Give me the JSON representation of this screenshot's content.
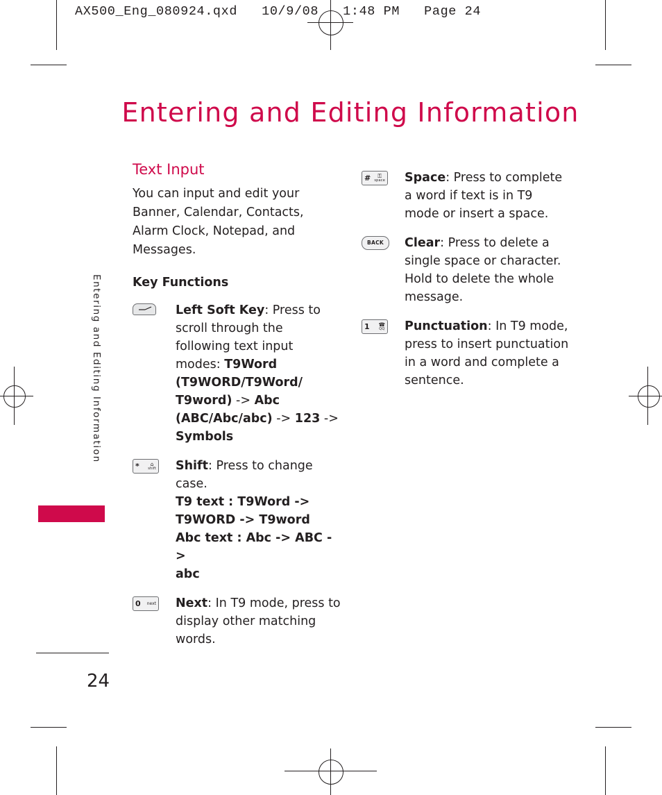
{
  "header": {
    "filestamp": "AX500_Eng_080924.qxd   10/9/08   1:48 PM   Page 24"
  },
  "page": {
    "title": "Entering and Editing Information",
    "running_head": "Entering and Editing Information",
    "folio": "24",
    "accent_color": "#CF0A4B",
    "text_color": "#231F20"
  },
  "left_column": {
    "section_head": "Text Input",
    "intro": "You can input and edit your Banner, Calendar, Contacts, Alarm Clock, Notepad, and Messages.",
    "sub_head": "Key Functions",
    "keys": [
      {
        "icon": "left-soft-key-icon",
        "label": "Left Soft Key",
        "text_plain": ": Press to scroll through the following text input modes: ",
        "text_bold_1": "T9Word (T9WORD/T9Word/ T9word)",
        "text_mid_1": " -> ",
        "text_bold_2": "Abc (ABC/Abc/abc)",
        "text_mid_2": " -> ",
        "text_bold_3": "123",
        "text_mid_3": " -> ",
        "text_bold_4": "Symbols"
      },
      {
        "icon": "star-shift-key-icon",
        "key_big": "*",
        "key_glyph": "⌂",
        "key_sub": "shift",
        "label": "Shift",
        "text_plain": ": Press to change case.",
        "lines_bold": [
          "T9 text : T9Word ->",
          "T9WORD -> T9word",
          "Abc text : Abc -> ABC ->",
          "abc"
        ]
      },
      {
        "icon": "zero-next-key-icon",
        "key_big": "0",
        "key_sub_word": "next",
        "label": "Next",
        "text_plain": ": In T9 mode, press to display other matching words."
      }
    ]
  },
  "right_column": {
    "keys": [
      {
        "icon": "pound-space-key-icon",
        "key_big": "#",
        "key_glyph": "⚿",
        "key_sub": "space",
        "label": "Space",
        "text_plain": ": Press to complete a word if text is in T9 mode or insert a space."
      },
      {
        "icon": "back-key-icon",
        "key_label": "BACK",
        "label": "Clear",
        "text_plain": ": Press to delete a single space or character. Hold to delete the whole message."
      },
      {
        "icon": "one-punctuation-key-icon",
        "key_big": "1",
        "key_glyph": "☎",
        "key_sub": "QQ",
        "label": "Punctuation",
        "text_plain": ": In T9 mode, press to insert punctuation in a word and complete a sentence."
      }
    ]
  }
}
